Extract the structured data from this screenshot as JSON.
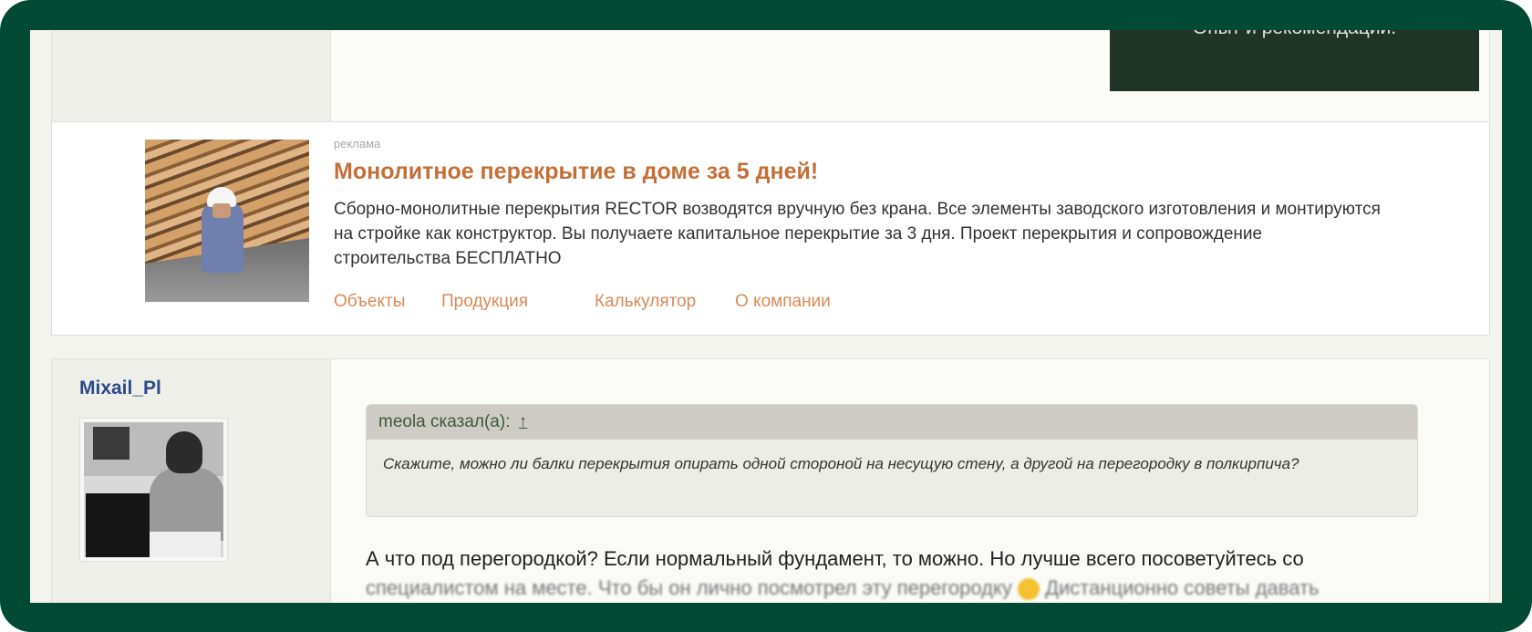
{
  "prev_post": {
    "banner_text": "Опыт и рекомендации."
  },
  "ad": {
    "label": "реклама",
    "title": "Монолитное перекрытие в доме за 5 дней!",
    "text": "Сборно-монолитные перекрытия RECTOR возводятся вручную без крана. Все элементы заводского изготовления и монтируются на стройке как конструктор. Вы получаете капитальное перекрытие за 3 дня. Проект перекрытия и сопровождение строительства БЕСПЛАТНО",
    "links": [
      "Объекты",
      "Продукция",
      "Калькулятор",
      "О компании"
    ]
  },
  "post": {
    "username": "Mixail_Pl",
    "quote": {
      "author": "meola сказал(а):",
      "arrow": "↑",
      "text": "Скажите, можно ли балки перекрытия опирать одной стороной на несущую стену, а другой на перегородку в полкирпича?"
    },
    "reply_line1": "А что под перегородкой? Если нормальный фундамент, то можно. Но лучше всего посоветуйтесь со",
    "reply_line2": "специалистом на месте. Что бы он лично посмотрел эту перегородку",
    "reply_line2_end": "Дистанционно советы давать"
  }
}
